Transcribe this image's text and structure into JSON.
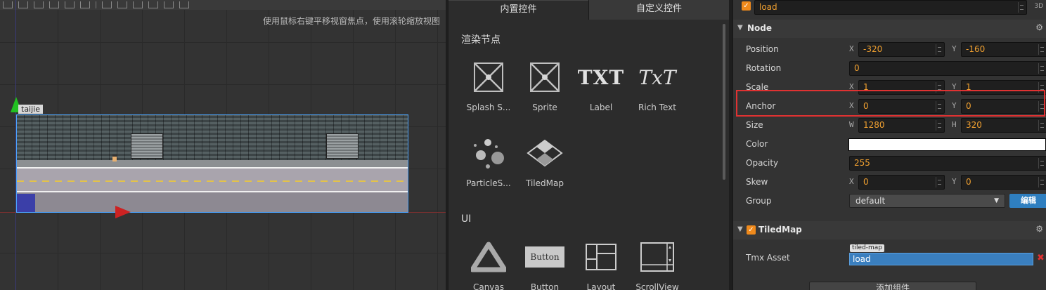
{
  "scene": {
    "hint": "使用鼠标右键平移视窗焦点，使用滚轮缩放视图",
    "node_label": "taijie"
  },
  "library": {
    "tabs": [
      "内置控件",
      "自定义控件"
    ],
    "section_render": "渲染节点",
    "render_items": [
      "Splash S...",
      "Sprite",
      "Label",
      "Rich Text",
      "ParticleS...",
      "TiledMap"
    ],
    "section_ui": "UI",
    "ui_items": [
      "Canvas",
      "Button",
      "Layout",
      "ScrollView"
    ],
    "label_icon_text": "TXT",
    "richtext_icon_text": "TxT",
    "button_icon_text": "Button"
  },
  "props": {
    "node_name": "load",
    "badge_3d": "3D",
    "node_section": "Node",
    "position": {
      "label": "Position",
      "x_axis": "X",
      "x": "-320",
      "y_axis": "Y",
      "y": "-160"
    },
    "rotation": {
      "label": "Rotation",
      "value": "0"
    },
    "scale": {
      "label": "Scale",
      "x_axis": "X",
      "x": "1",
      "y_axis": "Y",
      "y": "1"
    },
    "anchor": {
      "label": "Anchor",
      "x_axis": "X",
      "x": "0",
      "y_axis": "Y",
      "y": "0"
    },
    "size": {
      "label": "Size",
      "w_axis": "W",
      "w": "1280",
      "h_axis": "H",
      "h": "320"
    },
    "color": {
      "label": "Color",
      "value": "#ffffff"
    },
    "opacity": {
      "label": "Opacity",
      "value": "255"
    },
    "skew": {
      "label": "Skew",
      "x_axis": "X",
      "x": "0",
      "y_axis": "Y",
      "y": "0"
    },
    "group": {
      "label": "Group",
      "value": "default",
      "edit": "编辑"
    },
    "tiled_section": "TiledMap",
    "tmx": {
      "label": "Tmx Asset",
      "tag": "tiled-map",
      "value": "load"
    },
    "add_component": "添加组件"
  }
}
